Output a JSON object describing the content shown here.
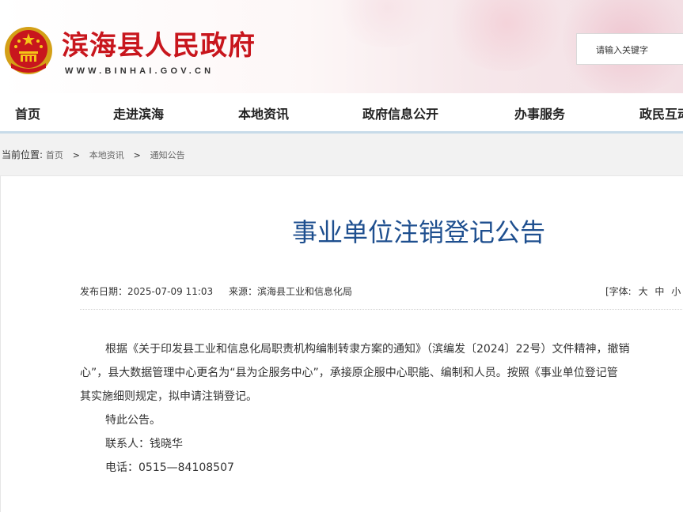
{
  "header": {
    "site_title": "滨海县人民政府",
    "site_url": "WWW.BINHAI.GOV.CN",
    "search_placeholder": "请输入关键字",
    "brand_color": "#c8161d"
  },
  "nav": {
    "items": [
      "首页",
      "走进滨海",
      "本地资讯",
      "政府信息公开",
      "办事服务",
      "政民互动"
    ]
  },
  "breadcrumb": {
    "label": "当前位置:",
    "items": [
      "首页",
      "本地资讯",
      "通知公告"
    ],
    "separator": ">"
  },
  "article": {
    "title": "事业单位注销登记公告",
    "title_color": "#1e4f8f",
    "publish_date": "发布日期：2025-07-09 11:03",
    "source": "来源：滨海县工业和信息化局",
    "font_label": "[字体:",
    "font_options": [
      "大",
      "中",
      "小"
    ],
    "paragraphs": [
      "根据《关于印发县工业和信息化局职责机构编制转隶方案的通知》（滨编发〔2024〕22号）文件精神，撤销",
      "心”，县大数据管理中心更名为“县为企服务中心”，承接原企服中心职能、编制和人员。按照《事业单位登记管",
      "其实施细则规定，拟申请注销登记。"
    ],
    "closing": "特此公告。",
    "contact": "联系人：钱晓华",
    "phone": "电话：0515—84108507"
  }
}
